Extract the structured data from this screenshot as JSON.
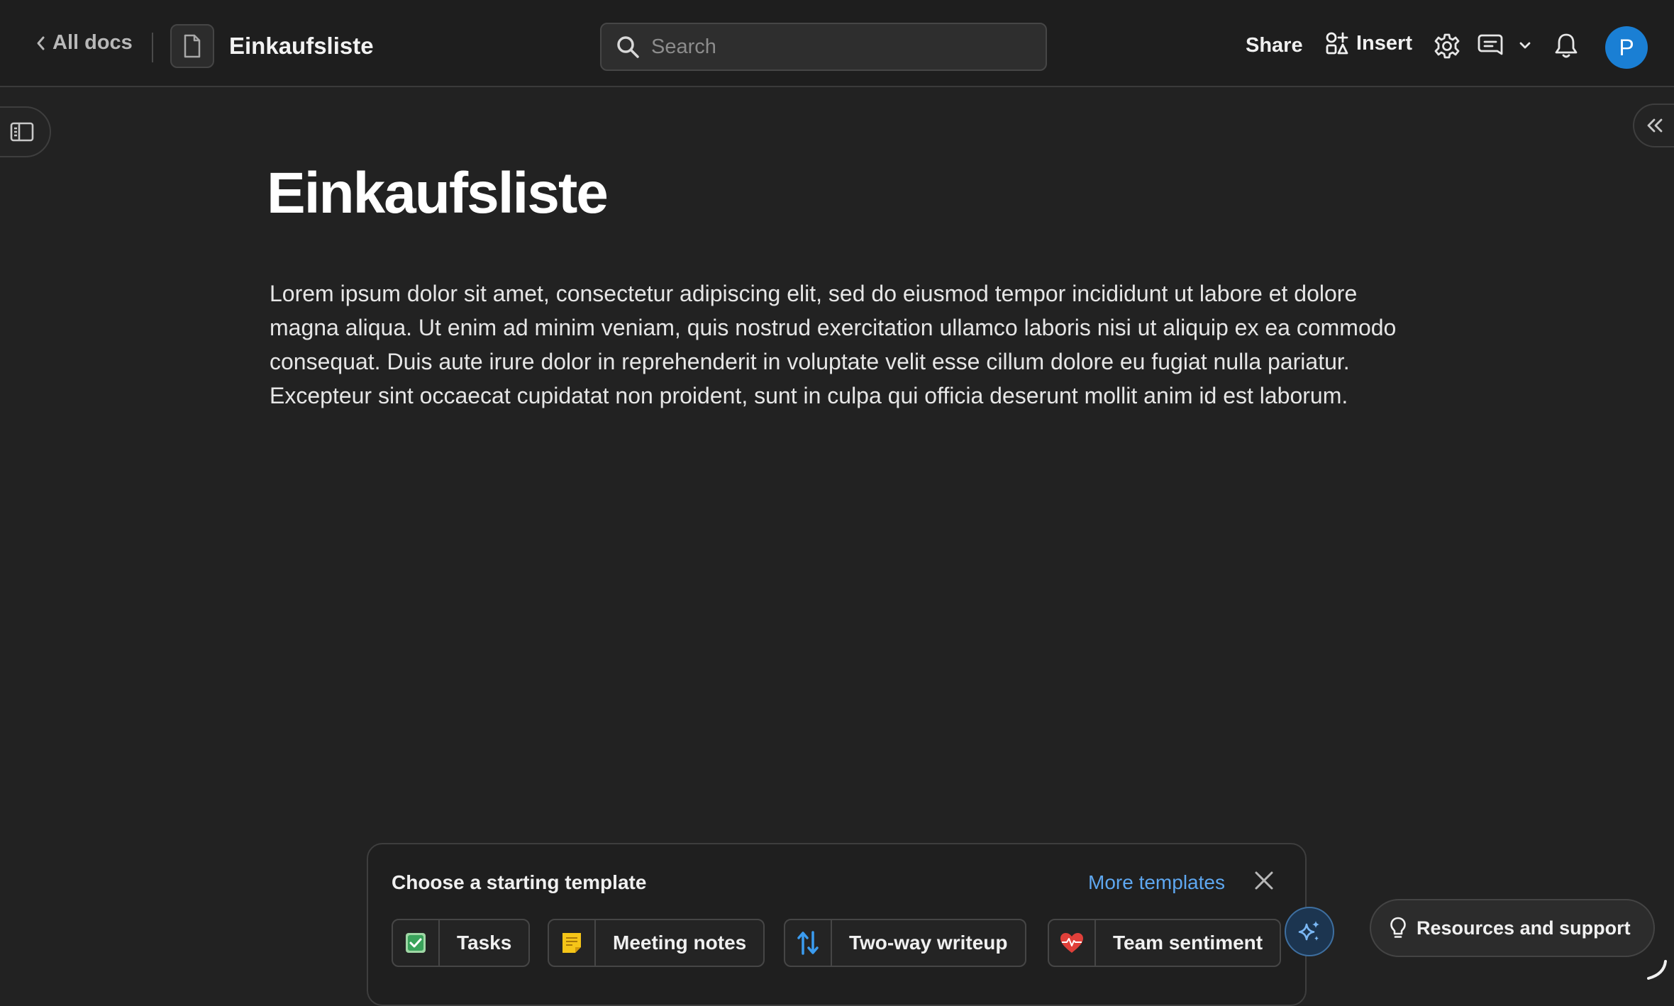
{
  "header": {
    "back_label": "All docs",
    "doc_title": "Einkaufsliste",
    "search_placeholder": "Search",
    "share_label": "Share",
    "insert_label": "Insert",
    "avatar_initial": "P"
  },
  "document": {
    "title": "Einkaufsliste",
    "body": "Lorem ipsum dolor sit amet, consectetur adipiscing elit, sed do eiusmod tempor incididunt ut labore et dolore magna aliqua. Ut enim ad minim veniam, quis nostrud exercitation ullamco laboris nisi ut aliquip ex ea commodo consequat. Duis aute irure dolor in reprehenderit in voluptate velit esse cillum dolore eu fugiat nulla pariatur. Excepteur sint occaecat cupidatat non proident, sunt in culpa qui officia deserunt mollit anim id est laborum."
  },
  "template_panel": {
    "heading": "Choose a starting template",
    "more_label": "More templates",
    "templates": [
      {
        "label": "Tasks",
        "icon": "checkbox-icon"
      },
      {
        "label": "Meeting notes",
        "icon": "sticky-note-icon"
      },
      {
        "label": "Two-way writeup",
        "icon": "up-down-arrows-icon"
      },
      {
        "label": "Team sentiment",
        "icon": "heart-pulse-icon"
      }
    ]
  },
  "support": {
    "label": "Resources and support"
  },
  "colors": {
    "accent_blue": "#1a7fd4",
    "link_blue": "#5ea7f0",
    "background": "#222222"
  }
}
